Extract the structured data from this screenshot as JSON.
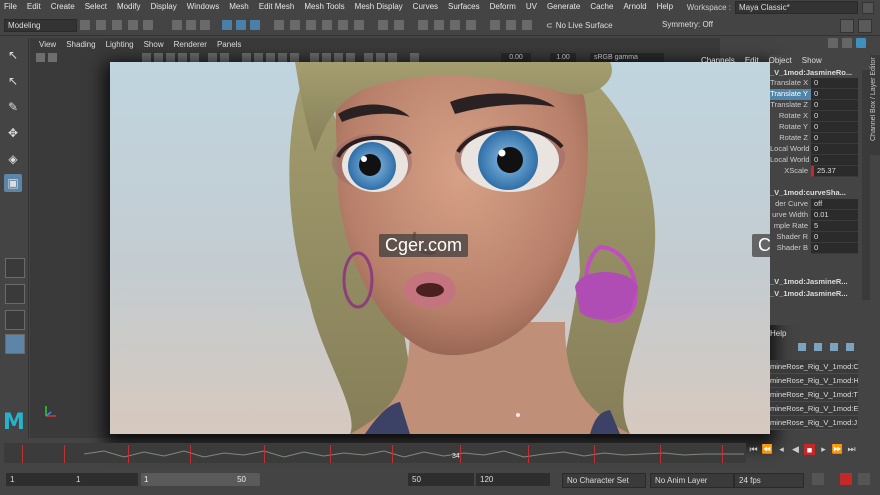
{
  "menubar": {
    "items": [
      "File",
      "Edit",
      "Create",
      "Select",
      "Modify",
      "Display",
      "Windows",
      "Mesh",
      "Edit Mesh",
      "Mesh Tools",
      "Mesh Display",
      "Curves",
      "Surfaces",
      "Deform",
      "UV",
      "Generate",
      "Cache",
      "Arnold",
      "Help"
    ],
    "workspace_label": "Workspace :",
    "workspace_value": "Maya Classic*"
  },
  "statusline": {
    "menuset": "Modeling",
    "live_surface": "No Live Surface",
    "symmetry": "Symmetry: Off"
  },
  "panel": {
    "menus": [
      "View",
      "Shading",
      "Lighting",
      "Show",
      "Renderer",
      "Panels"
    ],
    "field1": "0.00",
    "field2": "1.00",
    "colorspace": "sRGB gamma"
  },
  "watermark": "Cger.com",
  "channel_box": {
    "menus": [
      "Channels",
      "Edit",
      "Object",
      "Show"
    ],
    "vertical_tab": "Channel Box / Layer Editor",
    "object1": "_V_1mod:JasmineRo...",
    "rows1": [
      {
        "label": "Translate X",
        "value": "0"
      },
      {
        "label": "Translate Y",
        "value": "0"
      },
      {
        "label": "Translate Z",
        "value": "0"
      },
      {
        "label": "Rotate X",
        "value": "0"
      },
      {
        "label": "Rotate Y",
        "value": "0"
      },
      {
        "label": "Rotate Z",
        "value": "0"
      },
      {
        "label": "Local World",
        "value": "0"
      },
      {
        "label": "Local World",
        "value": "0"
      },
      {
        "label": "XScale",
        "value": "25.37"
      }
    ],
    "object2": "_V_1mod:curveSha...",
    "rows2": [
      {
        "label": "der Curve",
        "value": "off"
      },
      {
        "label": "urve Width",
        "value": "0.01"
      },
      {
        "label": "mple Rate",
        "value": "5"
      },
      {
        "label": "Shader R",
        "value": "0"
      },
      {
        "label": "Shader B",
        "value": "0"
      }
    ],
    "object3": "_V_1mod:JasmineR...",
    "object4": "_V_1mod:JasmineR..."
  },
  "layers": {
    "help": "Help",
    "items": [
      "mineRose_Rig_V_1mod:C",
      "mineRose_Rig_V_1mod:H",
      "mineRose_Rig_V_1mod:T",
      "mineRose_Rig_V_1mod:E",
      "mineRose_Rig_V_1mod:J"
    ]
  },
  "timeslider": {
    "current_frame": "34"
  },
  "range": {
    "start": "1",
    "anim_start": "1",
    "slider_start": "1",
    "slider_end": "50",
    "anim_end": "50",
    "end": "120",
    "character_set": "No Character Set",
    "anim_layer": "No Anim Layer",
    "fps": "24 fps"
  },
  "colors": {
    "ui_bg": "#444444",
    "highlight": "#5285a6",
    "maya_logo": "#27b4ca",
    "record": "#c42828"
  }
}
